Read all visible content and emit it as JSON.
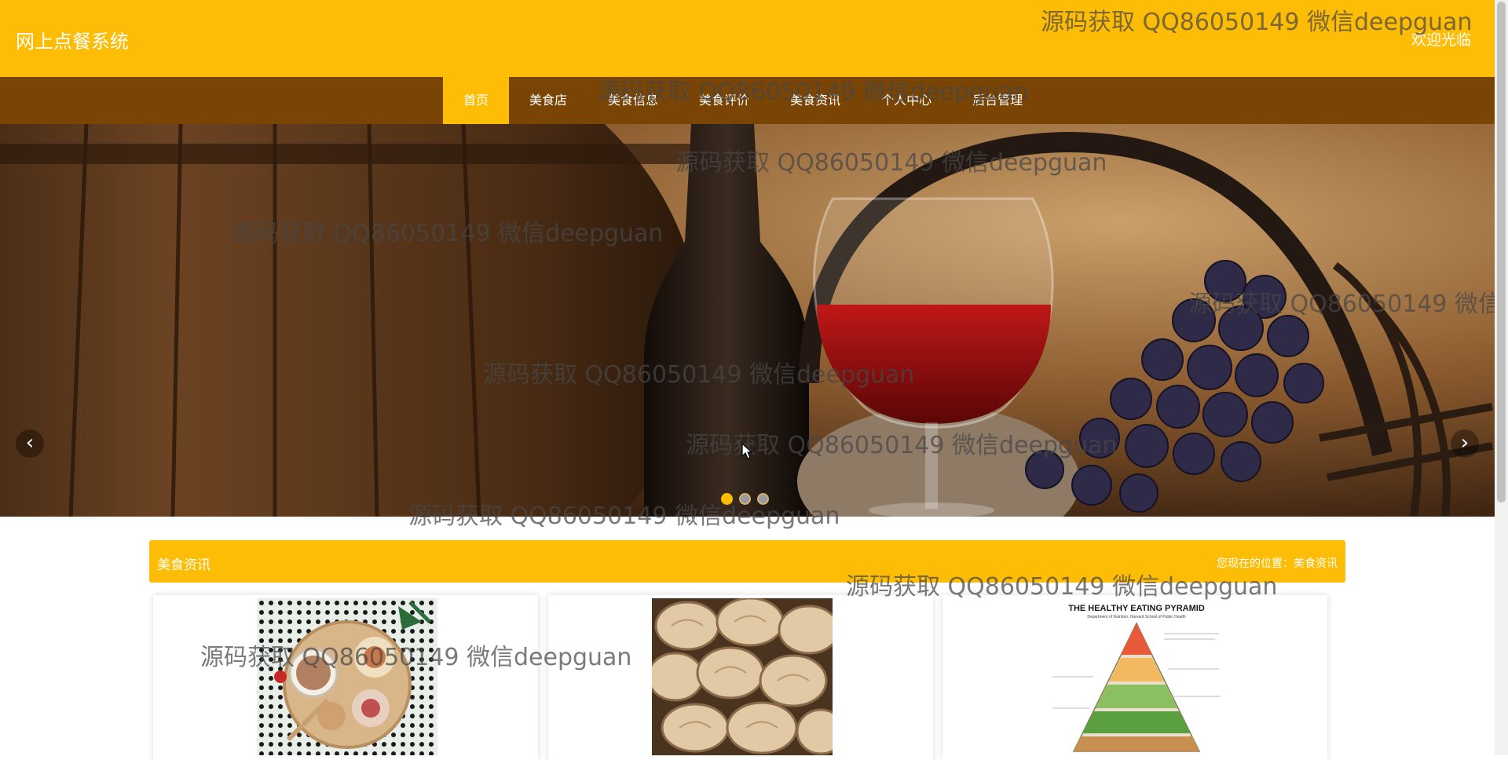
{
  "header": {
    "brand": "网上点餐系统",
    "welcome": "欢迎光临"
  },
  "nav": {
    "items": [
      {
        "label": "首页",
        "active": true
      },
      {
        "label": "美食店"
      },
      {
        "label": "美食信息"
      },
      {
        "label": "美食评价"
      },
      {
        "label": "美食资讯"
      },
      {
        "label": "个人中心"
      },
      {
        "label": "后台管理"
      }
    ]
  },
  "carousel": {
    "prev_icon": "chevron-left-icon",
    "next_icon": "chevron-right-icon",
    "slide_count": 3,
    "active_slide": 1
  },
  "section": {
    "title": "美食资讯",
    "breadcrumb": "您现在的位置：美食资讯"
  },
  "cards": [
    {
      "image": "cocoa-cookies-photo"
    },
    {
      "image": "bread-rolls-photo"
    },
    {
      "image": "healthy-eating-pyramid-poster",
      "poster_title": "THE HEALTHY EATING PYRAMID",
      "poster_subtitle": "Department of Nutrition, Harvard School of Public Health"
    }
  ],
  "watermark": "源码获取 QQ86050149 微信deepguan",
  "colors": {
    "accent": "#fdbc05",
    "nav_bg": "#7a4504"
  }
}
